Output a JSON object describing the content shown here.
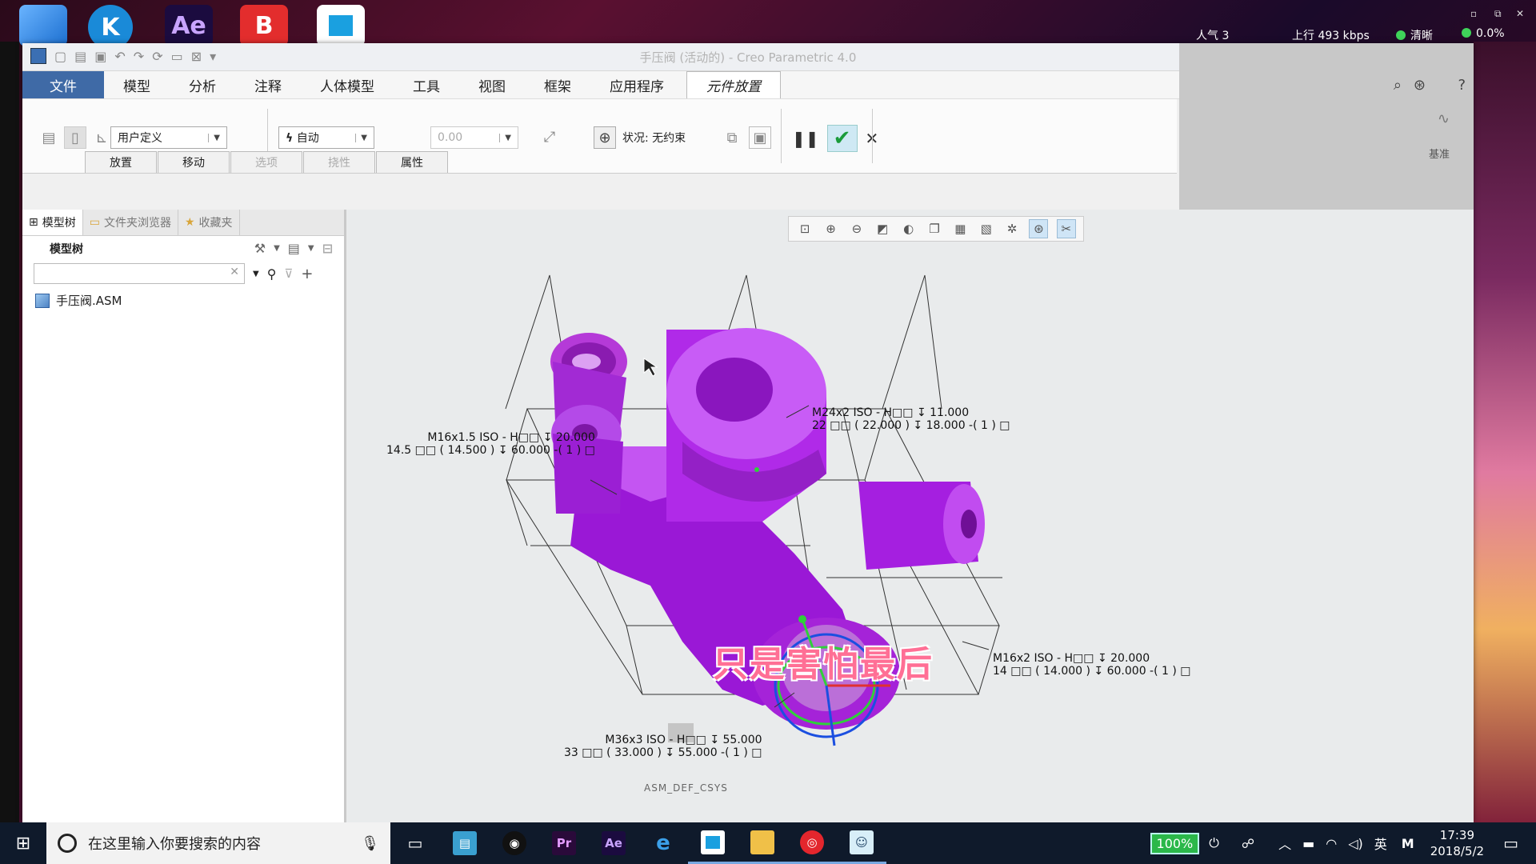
{
  "desktop": {
    "icons": [
      {
        "name": "folder-icon",
        "label": ""
      },
      {
        "name": "k-app-icon",
        "label": "K"
      },
      {
        "name": "ae-app-icon",
        "label": "Ae"
      },
      {
        "name": "b-app-icon",
        "label": "B"
      },
      {
        "name": "window-app-icon",
        "label": ""
      }
    ],
    "network": {
      "viewers": "人气 3",
      "upload": "上行 493 kbps",
      "quality": "清晰",
      "loss": "0.0%"
    }
  },
  "app": {
    "title": "手压阀 (活动的) - Creo Parametric 4.0",
    "menu": {
      "file": "文件",
      "items": [
        "模型",
        "分析",
        "注释",
        "人体模型",
        "工具",
        "视图",
        "框架",
        "应用程序"
      ],
      "context_tab": "元件放置"
    },
    "ribbon": {
      "constraint_type": "用户定义",
      "offset_type": "自动",
      "offset_value": "0.00",
      "status": "状况: 无约束",
      "right_panel_label": "基准",
      "subtabs": [
        "放置",
        "移动",
        "选项",
        "挠性",
        "属性"
      ]
    },
    "left_panel": {
      "tabs": [
        "模型树",
        "文件夹浏览器",
        "收藏夹"
      ],
      "tree_header": "模型树",
      "search_value": "",
      "tree_items": [
        "手压阀.ASM"
      ]
    },
    "graphics": {
      "annotations": {
        "top_right_1": "M24x2 ISO - H□□ ↧ 11.000",
        "top_right_2": "22 □□ ( 22.000 ) ↧ 18.000 -( 1 ) □",
        "left_1": "M16x1.5 ISO - H□□ ↧ 20.000",
        "left_2": "14.5 □□ ( 14.500 ) ↧ 60.000 -( 1 ) □",
        "right_1": "M16x2 ISO - H□□ ↧ 20.000",
        "right_2": "14 □□ ( 14.000 ) ↧ 60.000 -( 1 ) □",
        "bottom_1": "M36x3 ISO - H□□ ↧ 55.000",
        "bottom_2": "33 □□ ( 33.000 ) ↧ 55.000 -( 1 ) □"
      },
      "csys_label": "ASM_DEF_CSYS",
      "model_color": "#a81ee0",
      "subtitle": "只是害怕最后"
    }
  },
  "taskbar": {
    "search_placeholder": "在这里输入你要搜索的内容",
    "apps": [
      "task-view-icon",
      "explorer-window-icon",
      "qq-icon",
      "premiere-icon",
      "aftereffects-icon",
      "edge-icon",
      "creo-icon",
      "file-explorer-icon",
      "netease-music-icon",
      "game-icon"
    ],
    "battery": "100%",
    "ime": "英",
    "ime_mode": "M",
    "time": "17:39",
    "date": "2018/5/2"
  }
}
